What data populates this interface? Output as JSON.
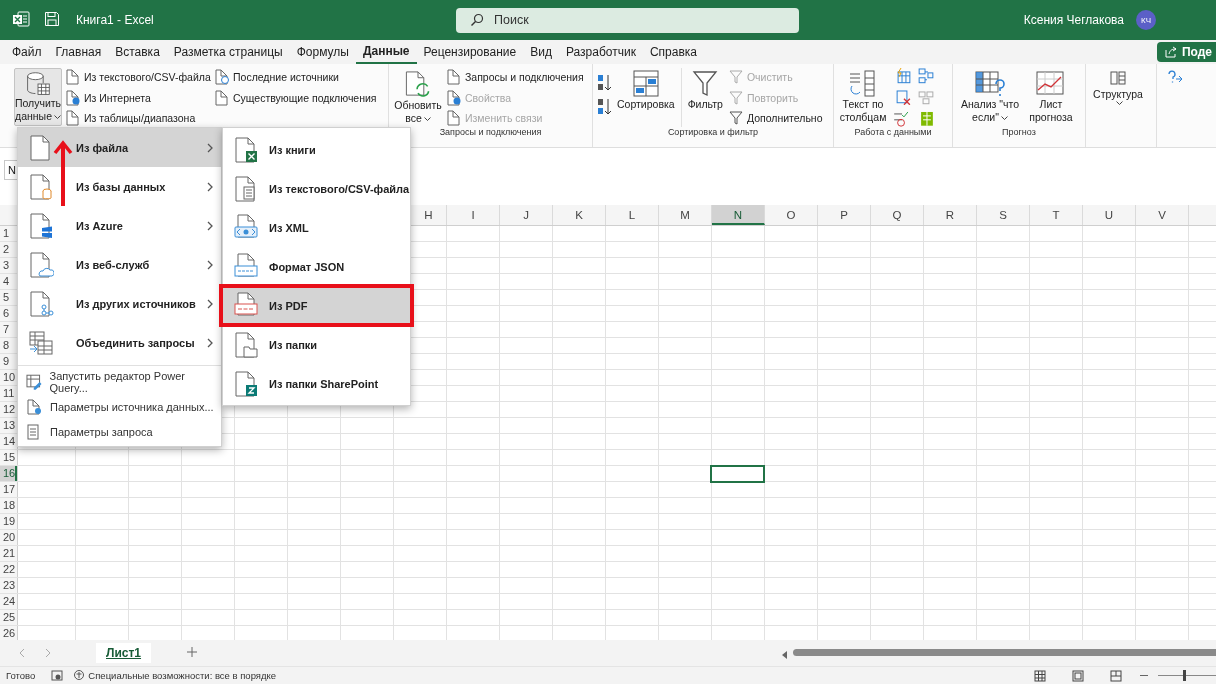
{
  "title_bar": {
    "title": "Книга1  -  Excel",
    "search_placeholder": "Поиск",
    "user_name": "Ксения Чеглакова",
    "user_initials": "КЧ",
    "share_button": "Поде"
  },
  "ribbon_tabs": [
    {
      "label": "Файл",
      "selected": false
    },
    {
      "label": "Главная",
      "selected": false
    },
    {
      "label": "Вставка",
      "selected": false
    },
    {
      "label": "Разметка страницы",
      "selected": false
    },
    {
      "label": "Формулы",
      "selected": false
    },
    {
      "label": "Данные",
      "selected": true
    },
    {
      "label": "Рецензирование",
      "selected": false
    },
    {
      "label": "Вид",
      "selected": false
    },
    {
      "label": "Разработчик",
      "selected": false
    },
    {
      "label": "Справка",
      "selected": false
    }
  ],
  "ribbon": {
    "get_data": {
      "label": "Получить данные",
      "pressed": true
    },
    "import_buttons": [
      {
        "label": "Из текстового/CSV-файла"
      },
      {
        "label": "Из Интернета"
      },
      {
        "label": "Из таблицы/диапазона"
      }
    ],
    "connection_buttons": [
      {
        "label": "Последние источники"
      },
      {
        "label": "Существующие подключения"
      }
    ],
    "queries_group": {
      "refresh_button": "Обновить все",
      "buttons": [
        {
          "label": "Запросы и подключения",
          "disabled": false
        },
        {
          "label": "Свойства",
          "disabled": true
        },
        {
          "label": "Изменить связи",
          "disabled": true
        }
      ],
      "label": "Запросы и подключения"
    },
    "sort_filter_group": {
      "sort_button": "Сортировка",
      "filter_button": "Фильтр",
      "buttons": [
        {
          "label": "Очистить",
          "disabled": true
        },
        {
          "label": "Повторить",
          "disabled": true
        },
        {
          "label": "Дополнительно",
          "disabled": false
        }
      ],
      "label": "Сортировка и фильтр"
    },
    "data_tools_group": {
      "text_to_columns_button": "Текст по столбцам",
      "label": "Работа с данными"
    },
    "forecast_group": {
      "what_if_button": "Анализ \"что если\"",
      "forecast_sheet_button": "Лист прогноза",
      "label": "Прогноз"
    },
    "outline_button": "Структура"
  },
  "name_box": "N",
  "columns": [
    {
      "label": "H",
      "selected": false
    },
    {
      "label": "I",
      "selected": false
    },
    {
      "label": "J",
      "selected": false
    },
    {
      "label": "K",
      "selected": false
    },
    {
      "label": "L",
      "selected": false
    },
    {
      "label": "M",
      "selected": false
    },
    {
      "label": "N",
      "selected": true
    },
    {
      "label": "O",
      "selected": false
    },
    {
      "label": "P",
      "selected": false
    },
    {
      "label": "Q",
      "selected": false
    },
    {
      "label": "R",
      "selected": false
    },
    {
      "label": "S",
      "selected": false
    },
    {
      "label": "T",
      "selected": false
    },
    {
      "label": "U",
      "selected": false
    },
    {
      "label": "V",
      "selected": false
    }
  ],
  "rows": [
    {
      "label": "1",
      "selected": false
    },
    {
      "label": "2",
      "selected": false
    },
    {
      "label": "3",
      "selected": false
    },
    {
      "label": "4",
      "selected": false
    },
    {
      "label": "5",
      "selected": false
    },
    {
      "label": "6",
      "selected": false
    },
    {
      "label": "7",
      "selected": false
    },
    {
      "label": "8",
      "selected": false
    },
    {
      "label": "9",
      "selected": false
    },
    {
      "label": "10",
      "selected": false
    },
    {
      "label": "11",
      "selected": false
    },
    {
      "label": "12",
      "selected": false
    },
    {
      "label": "13",
      "selected": false
    },
    {
      "label": "14",
      "selected": false
    },
    {
      "label": "15",
      "selected": false
    },
    {
      "label": "16",
      "selected": true
    },
    {
      "label": "17",
      "selected": false
    },
    {
      "label": "18",
      "selected": false
    },
    {
      "label": "19",
      "selected": false
    },
    {
      "label": "20",
      "selected": false
    },
    {
      "label": "21",
      "selected": false
    },
    {
      "label": "22",
      "selected": false
    },
    {
      "label": "23",
      "selected": false
    },
    {
      "label": "24",
      "selected": false
    },
    {
      "label": "25",
      "selected": false
    },
    {
      "label": "26",
      "selected": false
    }
  ],
  "get_data_menu": [
    {
      "label": "Из файла",
      "kind": "large",
      "selected": true,
      "has_submenu": true
    },
    {
      "label": "Из базы данных",
      "kind": "large",
      "selected": false,
      "has_submenu": true
    },
    {
      "label": "Из Azure",
      "kind": "large",
      "selected": false,
      "has_submenu": true
    },
    {
      "label": "Из веб-служб",
      "kind": "large",
      "selected": false,
      "has_submenu": true
    },
    {
      "label": "Из других источников",
      "kind": "large",
      "selected": false,
      "has_submenu": true
    },
    {
      "label": "Объединить запросы",
      "kind": "large",
      "selected": false,
      "has_submenu": true
    },
    {
      "label": "Запустить редактор Power Query...",
      "kind": "small"
    },
    {
      "label": "Параметры источника данных...",
      "kind": "small"
    },
    {
      "label": "Параметры запроса",
      "kind": "small"
    }
  ],
  "file_submenu": [
    {
      "label": "Из книги",
      "selected": false,
      "highlighted": false
    },
    {
      "label": "Из текстового/CSV-файла",
      "selected": false,
      "highlighted": false
    },
    {
      "label": "Из XML",
      "selected": false,
      "highlighted": false
    },
    {
      "label": "Формат JSON",
      "selected": false,
      "highlighted": false
    },
    {
      "label": "Из PDF",
      "selected": true,
      "highlighted": true
    },
    {
      "label": "Из папки",
      "selected": false,
      "highlighted": false
    },
    {
      "label": "Из папки SharePoint",
      "selected": false,
      "highlighted": false
    }
  ],
  "sheet_tabs": [
    {
      "label": "Лист1",
      "selected": true
    }
  ],
  "status_bar": {
    "ready": "Готово",
    "accessibility": "Специальные возможности: все в порядке",
    "zoom": {
      "level": 0.45
    }
  }
}
